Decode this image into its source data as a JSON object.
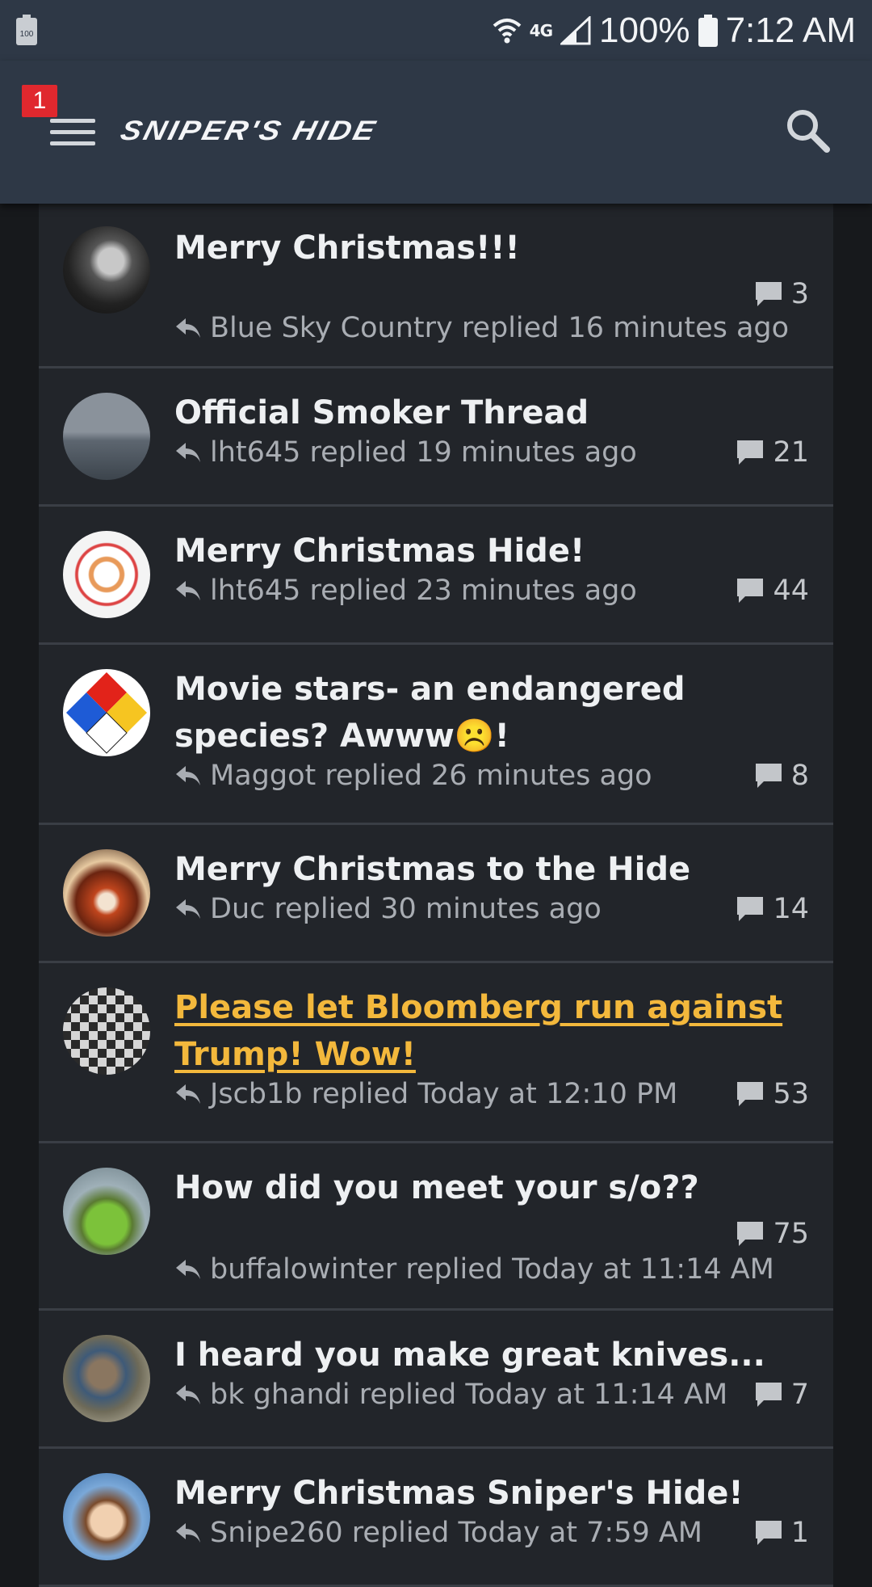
{
  "status_bar": {
    "battery_left_label": "100",
    "network": "4G",
    "battery_percent": "100%",
    "time": "7:12 AM",
    "icons": [
      "battery-icon",
      "wifi-icon",
      "signal-icon"
    ]
  },
  "header": {
    "notification_count": "1",
    "logo_text": "SNIPER'S HIDE",
    "icons": [
      "menu-icon",
      "search-icon"
    ]
  },
  "colors": {
    "header_bg": "#2e3846",
    "card_bg": "#22252a",
    "unread_title": "#f3b83c",
    "badge": "#e0282e"
  },
  "threads": [
    {
      "title": "Merry Christmas!!!",
      "replier": "Blue Sky Country",
      "replied_text": "Blue Sky Country replied 16 minutes ago",
      "replies": "3"
    },
    {
      "title": "Official Smoker Thread",
      "replier": "lht645",
      "replied_text": "lht645 replied 19 minutes ago",
      "replies": "21"
    },
    {
      "title": "Merry Christmas Hide!",
      "replier": "lht645",
      "replied_text": "lht645 replied 23 minutes ago",
      "replies": "44"
    },
    {
      "title": "Movie stars- an endangered species? Awww☹️!",
      "replier": "Maggot",
      "replied_text": "Maggot replied 26 minutes ago",
      "replies": "8"
    },
    {
      "title": "Merry Christmas to the Hide",
      "replier": "Duc",
      "replied_text": "Duc replied 30 minutes ago",
      "replies": "14"
    },
    {
      "title": "Please let Bloomberg run against Trump! Wow!",
      "replier": "Jscb1b",
      "replied_text": "Jscb1b replied Today at 12:10 PM",
      "replies": "53",
      "unread": true
    },
    {
      "title": "How did you meet your s/o??",
      "replier": "buffalowinter",
      "replied_text": "buffalowinter replied Today at 11:14 AM",
      "replies": "75"
    },
    {
      "title": "I heard you make great knives...",
      "replier": "bk ghandi",
      "replied_text": "bk ghandi replied Today at 11:14 AM",
      "replies": "7"
    },
    {
      "title": "Merry Christmas Sniper's Hide!",
      "replier": "Snipe260",
      "replied_text": "Snipe260 replied Today at 7:59 AM",
      "replies": "1"
    }
  ]
}
